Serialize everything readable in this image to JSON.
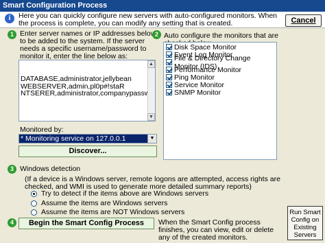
{
  "window": {
    "title": "Smart Configuration Process"
  },
  "header": {
    "text": "Here you can quickly configure new servers with auto-configured monitors. When the process is complete, you can modify any setting that is created.",
    "cancel_label": "Cancel"
  },
  "step1": {
    "number": "1",
    "instructions": "Enter server names or IP addresses below to be added to the system. If the server needs a specific username/password to monitor it, enter the line below as: server,username,password",
    "servers_text": "DATABASE,administrator,jellybean\nWEBSERVER,admin,pl0p#!staR\nNTSERER,administrator,companypassword",
    "monitored_by_label": "Monitored by:",
    "monitored_by_value": "* Monitoring service on 127.0.0.1",
    "discover_label": "Discover..."
  },
  "step2": {
    "number": "2",
    "label": "Auto configure the monitors that are checked below",
    "monitors": [
      {
        "label": "Disk Space Monitor",
        "checked": true
      },
      {
        "label": "Event Log Monitor",
        "checked": true
      },
      {
        "label": "File & Directory Change Monitor (IDS)",
        "checked": true
      },
      {
        "label": "Performance Monitor",
        "checked": true
      },
      {
        "label": "Ping Monitor",
        "checked": true
      },
      {
        "label": "Service Monitor",
        "checked": true
      },
      {
        "label": "SNMP Monitor",
        "checked": true
      }
    ]
  },
  "step3": {
    "number": "3",
    "label": "Windows detection",
    "description": "(If a device is a Windows server, remote logons are attempted, access rights are checked, and WMI is used to generate more detailed summary reports)",
    "options": [
      {
        "label": "Try to detect if the items above are Windows servers",
        "selected": true
      },
      {
        "label": "Assume the items are Windows servers",
        "selected": false
      },
      {
        "label": "Assume the items are NOT Windows servers",
        "selected": false
      }
    ]
  },
  "step4": {
    "number": "4",
    "begin_label": "Begin the Smart Config Process",
    "note": "When the Smart Config process finishes, you can view, edit or delete any of the created monitors.",
    "run_label": "Run Smart Config on Existing Servers"
  },
  "colors": {
    "title_bar": "#17498f",
    "step_badge": "#2f9b2f",
    "selected": "#0a246a"
  },
  "icons": {
    "header": "info-icon",
    "step": "step-number-icon"
  }
}
